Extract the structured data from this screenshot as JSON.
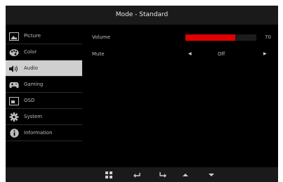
{
  "window": {
    "title": "Mode - Standard"
  },
  "sidebar": {
    "items": [
      {
        "label": "Picture",
        "icon": "picture-icon",
        "active": false
      },
      {
        "label": "Color",
        "icon": "color-palette-icon",
        "active": false
      },
      {
        "label": "Audio",
        "icon": "speaker-icon",
        "active": true
      },
      {
        "label": "Gaming",
        "icon": "gamepad-icon",
        "active": false
      },
      {
        "label": "OSD",
        "icon": "osd-window-icon",
        "active": false
      },
      {
        "label": "System",
        "icon": "gear-icon",
        "active": false
      },
      {
        "label": "Information",
        "icon": "info-icon",
        "active": false
      }
    ]
  },
  "settings": {
    "volume": {
      "label": "Volume",
      "value": "70",
      "level_percent": 70,
      "bar_color": "#e00000"
    },
    "mute": {
      "label": "Mute",
      "value": "Off"
    }
  },
  "footer": {
    "icons": [
      "menu-grid-icon",
      "back-icon",
      "enter-icon",
      "up-arrow-icon",
      "down-arrow-icon"
    ]
  }
}
